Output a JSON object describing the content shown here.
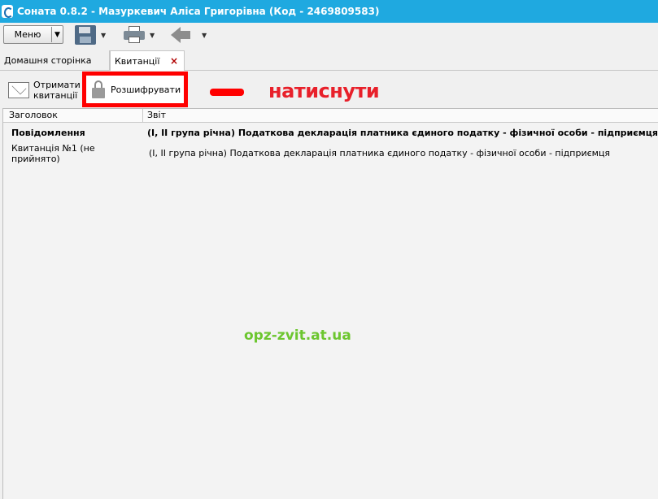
{
  "window": {
    "title": "Соната 0.8.2 - Мазуркевич Аліса Григорівна (Код - 2469809583)"
  },
  "toolbar": {
    "menu_label": "Меню",
    "icons": [
      "save-icon",
      "print-icon",
      "back-arrow-icon"
    ]
  },
  "tabs": [
    {
      "label": "Домашня сторінка",
      "active": false
    },
    {
      "label": "Квитанції",
      "active": true,
      "closable": true
    }
  ],
  "actions": {
    "receive_label": "Отримати\nквитанції",
    "decrypt_label": "Розшифрувати"
  },
  "annotation": {
    "callout": "натиснути",
    "highlight_color": "#ff0000"
  },
  "grid": {
    "columns": [
      "Заголовок",
      "Звіт"
    ],
    "rows": [
      {
        "title": "Повідомлення",
        "report": "(I, II група річна) Податкова декларація платника єдиного податку - фізичної особи - підприємця",
        "bold": true
      },
      {
        "title": "Квитанція №1 (не прийнято)",
        "report": "(I, II група річна) Податкова декларація платника єдиного податку - фізичної особи - підприємця",
        "bold": false
      }
    ]
  },
  "watermark": "opz-zvit.at.ua",
  "colors": {
    "titlebar": "#1fa9e0",
    "callout": "#e8202a",
    "watermark": "#6cc62f"
  }
}
